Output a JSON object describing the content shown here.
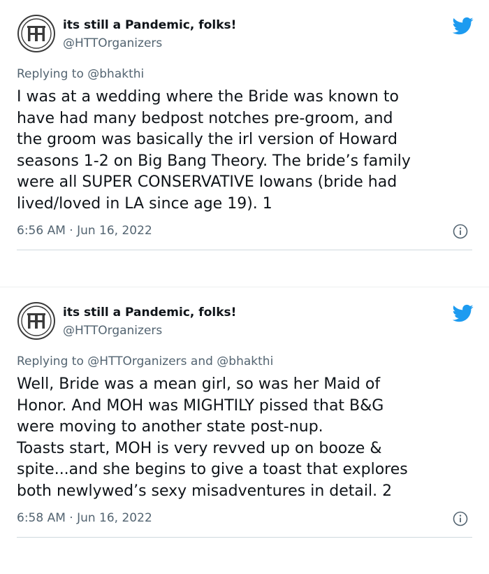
{
  "colors": {
    "text": "#0f1419",
    "secondary": "#536471",
    "twitter_blue": "#1d9bf0",
    "divider": "#cfd9de"
  },
  "tweets": [
    {
      "display_name": "its still a Pandemic, folks!",
      "handle": "@HTTOrganizers",
      "replying_prefix": "Replying to",
      "replying_to": "@bhakthi",
      "text": "I was at a wedding where the Bride was known to\nhave had many bedpost notches pre-groom, and\nthe groom was basically the irl version of Howard\nseasons 1-2 on Big Bang Theory. The bride’s family\nwere all SUPER CONSERVATIVE Iowans (bride had\nlived/loved in LA since age 19). 1",
      "timestamp": "6:56 AM · Jun 16, 2022",
      "avatar_icon": "htt-logo-avatar",
      "brand_icon": "twitter-bird-icon",
      "info_icon": "info-icon"
    },
    {
      "display_name": "its still a Pandemic, folks!",
      "handle": "@HTTOrganizers",
      "replying_prefix": "Replying to",
      "replying_to": "@HTTOrganizers and @bhakthi",
      "text": "Well, Bride was a mean girl, so was her Maid of\nHonor. And MOH was MIGHTILY pissed that B&G\nwere moving to another state post-nup.\nToasts start, MOH is very revved up on booze &\nspite...and she begins to give a toast that explores\nboth newlywed’s sexy misadventures in detail. 2",
      "timestamp": "6:58 AM · Jun 16, 2022",
      "avatar_icon": "htt-logo-avatar",
      "brand_icon": "twitter-bird-icon",
      "info_icon": "info-icon"
    }
  ]
}
